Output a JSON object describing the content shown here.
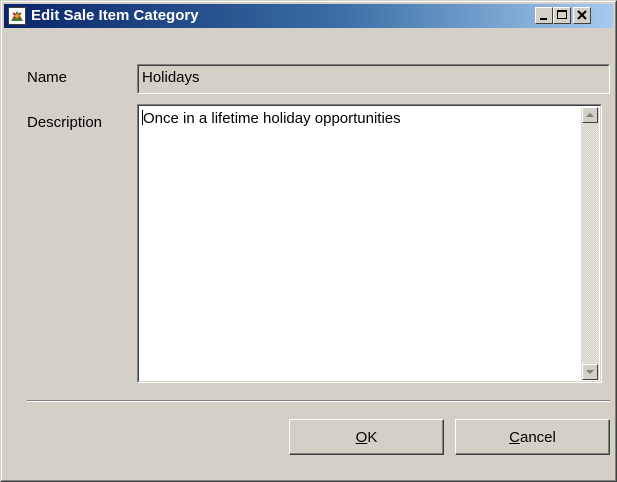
{
  "window": {
    "title": "Edit Sale Item Category",
    "caption_buttons": {
      "minimize": "minimize-icon",
      "maximize": "maximize-icon",
      "close": "close-icon"
    }
  },
  "form": {
    "name_label": "Name",
    "name_value": "Holidays",
    "description_label": "Description",
    "description_value": "Once in a lifetime holiday opportunities"
  },
  "buttons": {
    "ok": {
      "mnemonic": "O",
      "rest": "K"
    },
    "cancel": {
      "mnemonic": "C",
      "rest": "ancel"
    }
  },
  "colors": {
    "face": "#d4d0c8",
    "title_start": "#0a246a",
    "title_end": "#a6caf0",
    "field_bg_readonly": "#d4d0c8",
    "field_bg": "#ffffff"
  }
}
